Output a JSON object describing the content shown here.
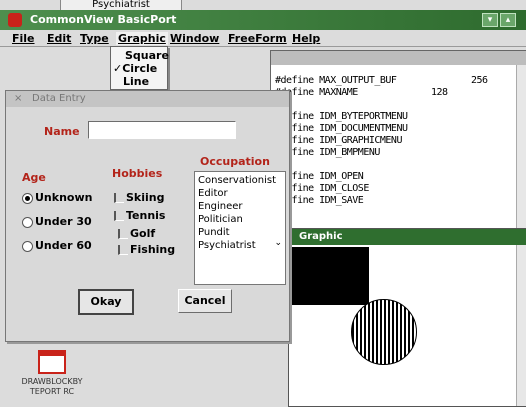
{
  "background_window": {
    "fragment_title": "Psychiatrist"
  },
  "app": {
    "title": "CommonView BasicPort",
    "menu": [
      "File",
      "Edit",
      "Type",
      "Graphic",
      "Window",
      "FreeForm",
      "Help"
    ]
  },
  "graphic_menu": {
    "items": [
      "Square",
      "Circle",
      "Line"
    ],
    "checked": "Circle"
  },
  "code_window": {
    "lines": [
      {
        "text": "#define MAX_OUTPUT_BUF",
        "value": "256"
      },
      {
        "text": "#define MAXNAME",
        "value": "128"
      },
      {
        "text": "#define IDM_BYTEPORTMENU",
        "value": ""
      },
      {
        "text": "#define IDM_DOCUMENTMENU",
        "value": ""
      },
      {
        "text": "#define IDM_GRAPHICMENU",
        "value": ""
      },
      {
        "text": "#define IDM_BMPMENU",
        "value": ""
      },
      {
        "text": "#define IDM_OPEN",
        "value": ""
      },
      {
        "text": "#define IDM_CLOSE",
        "value": ""
      },
      {
        "text": "#define IDM_SAVE",
        "value": ""
      }
    ]
  },
  "graphic_window": {
    "title": "Graphic"
  },
  "dialog": {
    "title": "Data Entry",
    "name_label": "Name",
    "name_value": "",
    "age_label": "Age",
    "age_options": [
      "Unknown",
      "Under 30",
      "Under 60"
    ],
    "age_selected": "Unknown",
    "hobbies_label": "Hobbies",
    "hobbies": [
      "Skiing",
      "Tennis",
      "Golf",
      "Fishing"
    ],
    "occupation_label": "Occupation",
    "occupations": [
      "Conservationist",
      "Editor",
      "Engineer",
      "Politician",
      "Pundit",
      "Psychiatrist"
    ],
    "ok_label": "Okay",
    "cancel_label": "Cancel"
  },
  "desktop_icon": {
    "label": "DRAWBLOCKBY\nTEPORT RC"
  },
  "colors": {
    "title_green": "#2e6b2e",
    "label_red": "#b3241a"
  }
}
